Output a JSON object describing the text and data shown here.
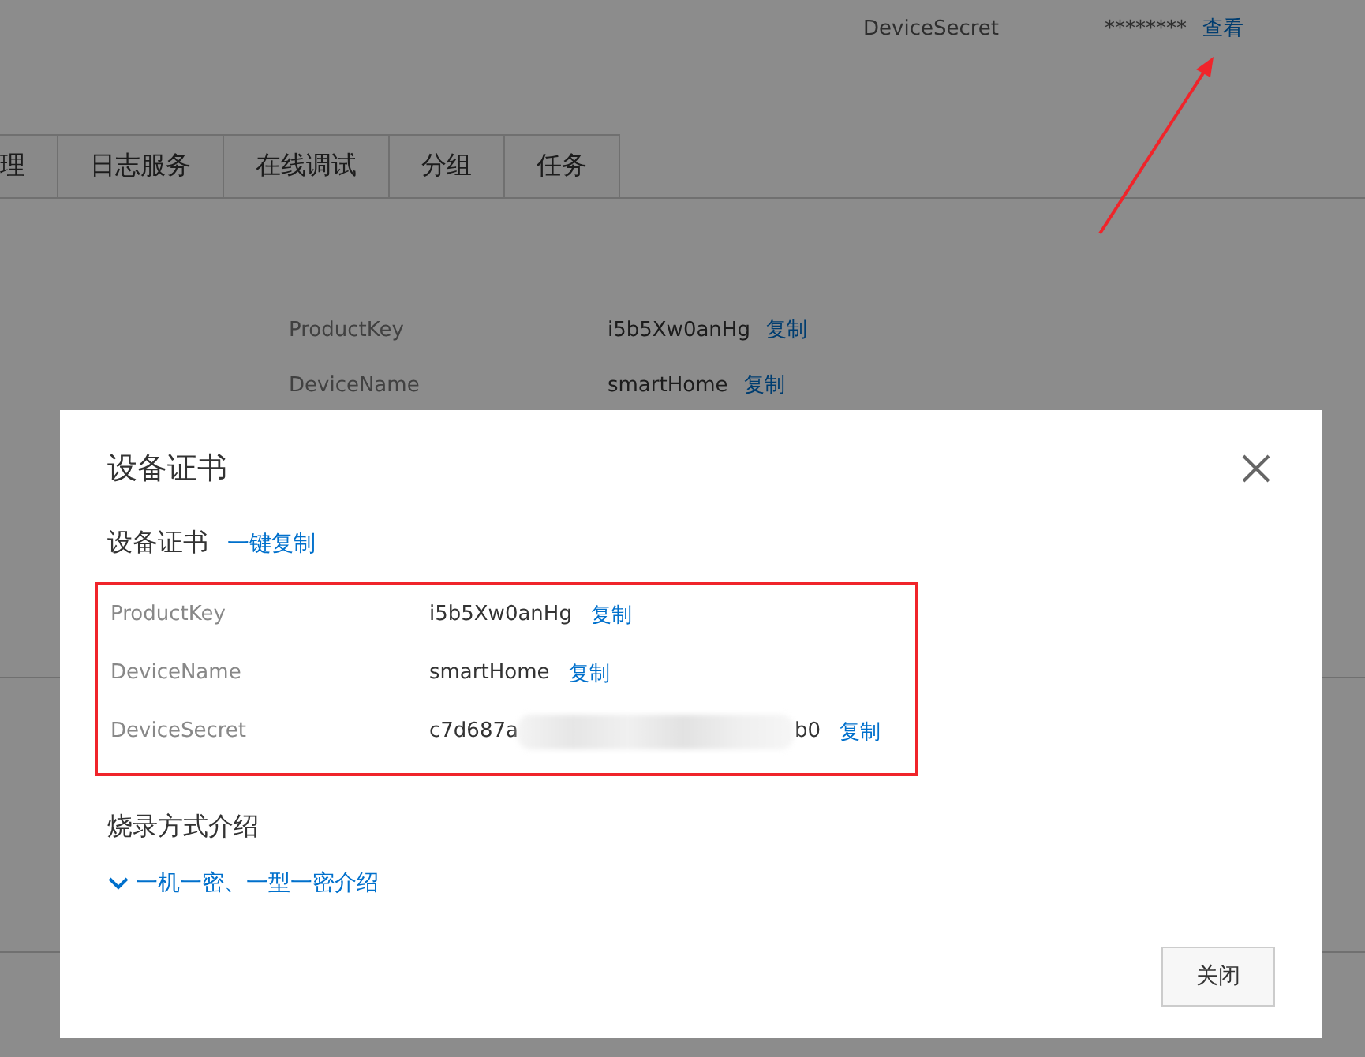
{
  "page": {
    "secret_row": {
      "label": "DeviceSecret",
      "value": "********",
      "link": "查看"
    },
    "tabs": [
      {
        "label": "理",
        "selected": false
      },
      {
        "label": "日志服务",
        "selected": false
      },
      {
        "label": "在线调试",
        "selected": false
      },
      {
        "label": "分组",
        "selected": false
      },
      {
        "label": "任务",
        "selected": false
      }
    ],
    "info": [
      {
        "label": "ProductKey",
        "value": "i5b5Xw0anHg",
        "link": "复制"
      },
      {
        "label": "DeviceName",
        "value": "smartHome",
        "link": "复制"
      }
    ]
  },
  "dialog": {
    "title": "设备证书",
    "certificate": {
      "heading": "设备证书",
      "copy_all": "一键复制",
      "rows": [
        {
          "label": "ProductKey",
          "value": "i5b5Xw0anHg",
          "link": "复制",
          "masked": false
        },
        {
          "label": "DeviceName",
          "value": "smartHome",
          "link": "复制",
          "masked": false
        },
        {
          "label": "DeviceSecret",
          "value": "c7d687a",
          "value_end": "b0",
          "link": "复制",
          "masked": true
        }
      ]
    },
    "burn": {
      "heading": "烧录方式介绍",
      "toggle": "一机一密、一型一密介绍",
      "expanded": false
    },
    "buttons": [
      "关闭"
    ]
  }
}
